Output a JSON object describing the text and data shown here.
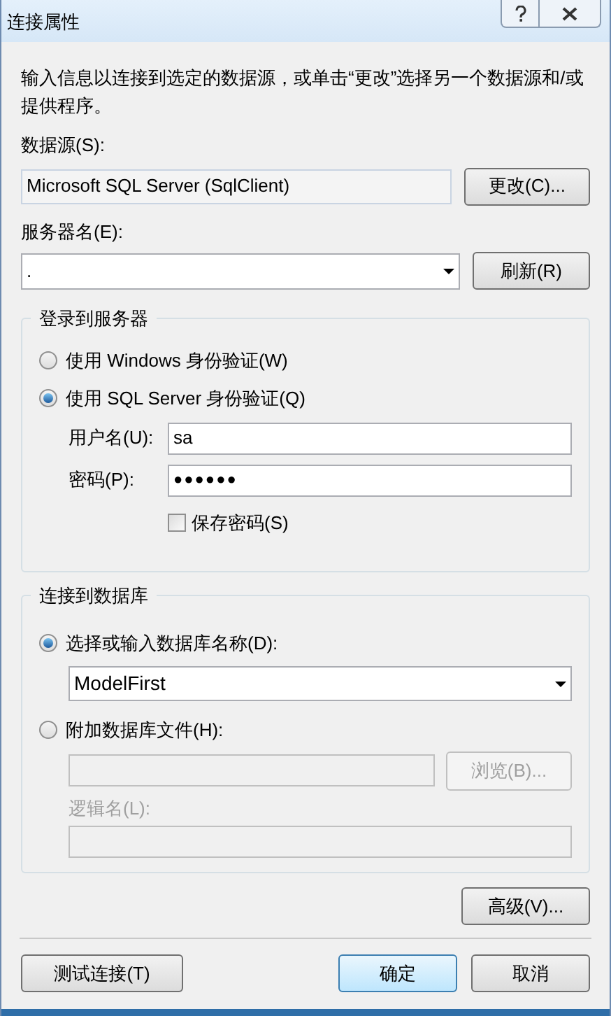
{
  "window": {
    "title": "连接属性"
  },
  "intro": "输入信息以连接到选定的数据源，或单击“更改”选择另一个数据源和/或提供程序。",
  "data_source": {
    "label": "数据源(S):",
    "value": "Microsoft SQL Server (SqlClient)",
    "button": "更改(C)..."
  },
  "server": {
    "label": "服务器名(E):",
    "value": ".",
    "button": "刷新(R)"
  },
  "login": {
    "title": "登录到服务器",
    "options": [
      {
        "label": "使用 Windows 身份验证(W)",
        "selected": false
      },
      {
        "label": "使用 SQL Server 身份验证(Q)",
        "selected": true
      }
    ],
    "username": {
      "label": "用户名(U):",
      "value": "sa"
    },
    "password": {
      "label": "密码(P):",
      "value": "●●●●●●"
    },
    "save_password": {
      "label": "保存密码(S)",
      "checked": false
    }
  },
  "database": {
    "title": "连接到数据库",
    "select": {
      "label": "选择或输入数据库名称(D):",
      "selected": true,
      "value": "ModelFirst"
    },
    "attach": {
      "label": "附加数据库文件(H):",
      "selected": false,
      "disabled": true,
      "button": "浏览(B)...",
      "logical_name_label": "逻辑名(L):"
    }
  },
  "buttons": {
    "advanced": "高级(V)...",
    "test": "测试连接(T)",
    "ok": "确定",
    "cancel": "取消"
  }
}
